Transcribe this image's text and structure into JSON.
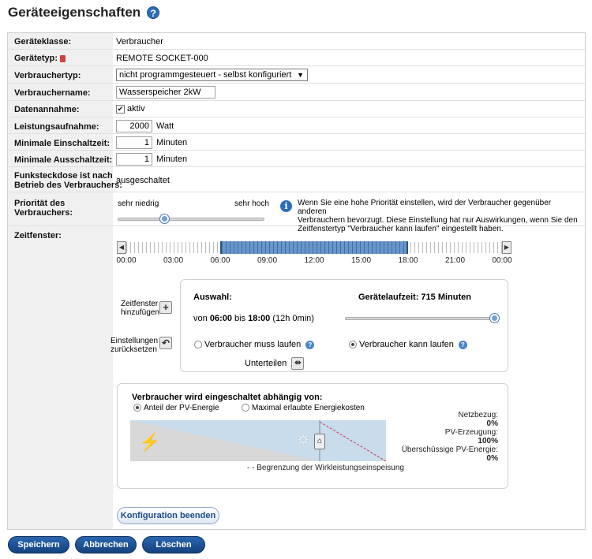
{
  "page": {
    "title": "Geräteeigenschaften"
  },
  "fields": {
    "klasse_label": "Geräteklasse:",
    "klasse_value": "Verbraucher",
    "typ_label": "Gerätetyp:",
    "typ_value": "REMOTE SOCKET-000",
    "vtyp_label": "Verbrauchertyp:",
    "vtyp_value": "nicht programmgesteuert - selbst konfiguriert",
    "name_label": "Verbrauchername:",
    "name_value": "Wasserspeicher 2kW",
    "daten_label": "Datenannahme:",
    "daten_value": "aktiv",
    "leistung_label": "Leistungsaufnahme:",
    "leistung_value": "2000",
    "leistung_unit": "Watt",
    "min_ein_label": "Minimale Einschaltzeit:",
    "min_ein_value": "1",
    "min_ein_unit": "Minuten",
    "min_aus_label": "Minimale Ausschaltzeit:",
    "min_aus_value": "1",
    "min_aus_unit": "Minuten",
    "funk_label_1": "Funksteckdose ist nach",
    "funk_label_2": "Betrieb des Verbrauchers:",
    "funk_value": "ausgeschaltet",
    "prio_label_1": "Priorität des",
    "prio_label_2": "Verbrauchers:",
    "prio_low": "sehr niedrig",
    "prio_high": "sehr hoch",
    "prio_level": 0.33,
    "prio_info_1": "Wenn Sie eine hohe Priorität einstellen, wird der Verbraucher gegenüber anderen",
    "prio_info_2": "Verbrauchern bevorzugt. Diese Einstellung hat nur Auswirkungen, wenn Sie den",
    "prio_info_3": "Zeitfenstertyp \"Verbraucher kann laufen\" eingestellt haben.",
    "zeit_label": "Zeitfenster:"
  },
  "timeline": {
    "labels": [
      "00:00",
      "03:00",
      "06:00",
      "09:00",
      "12:00",
      "15:00",
      "18:00",
      "21:00",
      "00:00"
    ],
    "selection_start_hour": 6,
    "selection_end_hour": 18
  },
  "window": {
    "add_label_1": "Zeitfenster",
    "add_label_2": "hinzufügen",
    "reset_label_1": "Einstellungen",
    "reset_label_2": "zurücksetzen",
    "auswahl_title": "Auswahl:",
    "laufzeit_title": "Gerätelaufzeit: 715 Minuten",
    "von": "von",
    "start": "06:00",
    "bis": "bis",
    "end": "18:00",
    "duration": "(12h 0min)",
    "laufzeit_level": 1.0,
    "muss_label": "Verbraucher muss laufen",
    "kann_label": "Verbraucher kann laufen",
    "unterteilen_label": "Unterteilen"
  },
  "pv": {
    "title": "Verbraucher wird eingeschaltet abhängig von:",
    "opt_pv": "Anteil der PV-Energie",
    "opt_cost": "Maximal erlaubte Energiekosten",
    "netzbezug_label": "Netzbezug:",
    "netzbezug_value": "0%",
    "erzeugung_label": "PV-Erzeugung:",
    "erzeugung_value": "100%",
    "ueberschuss_label": "Überschüssige PV-Energie:",
    "ueberschuss_value": "0%",
    "legend": "- - Begrenzung der Wirkleistungseinspeisung",
    "slider_level": 0.8
  },
  "buttons": {
    "konfig_end": "Konfiguration beenden",
    "save": "Speichern",
    "cancel": "Abbrechen",
    "delete": "Löschen"
  }
}
